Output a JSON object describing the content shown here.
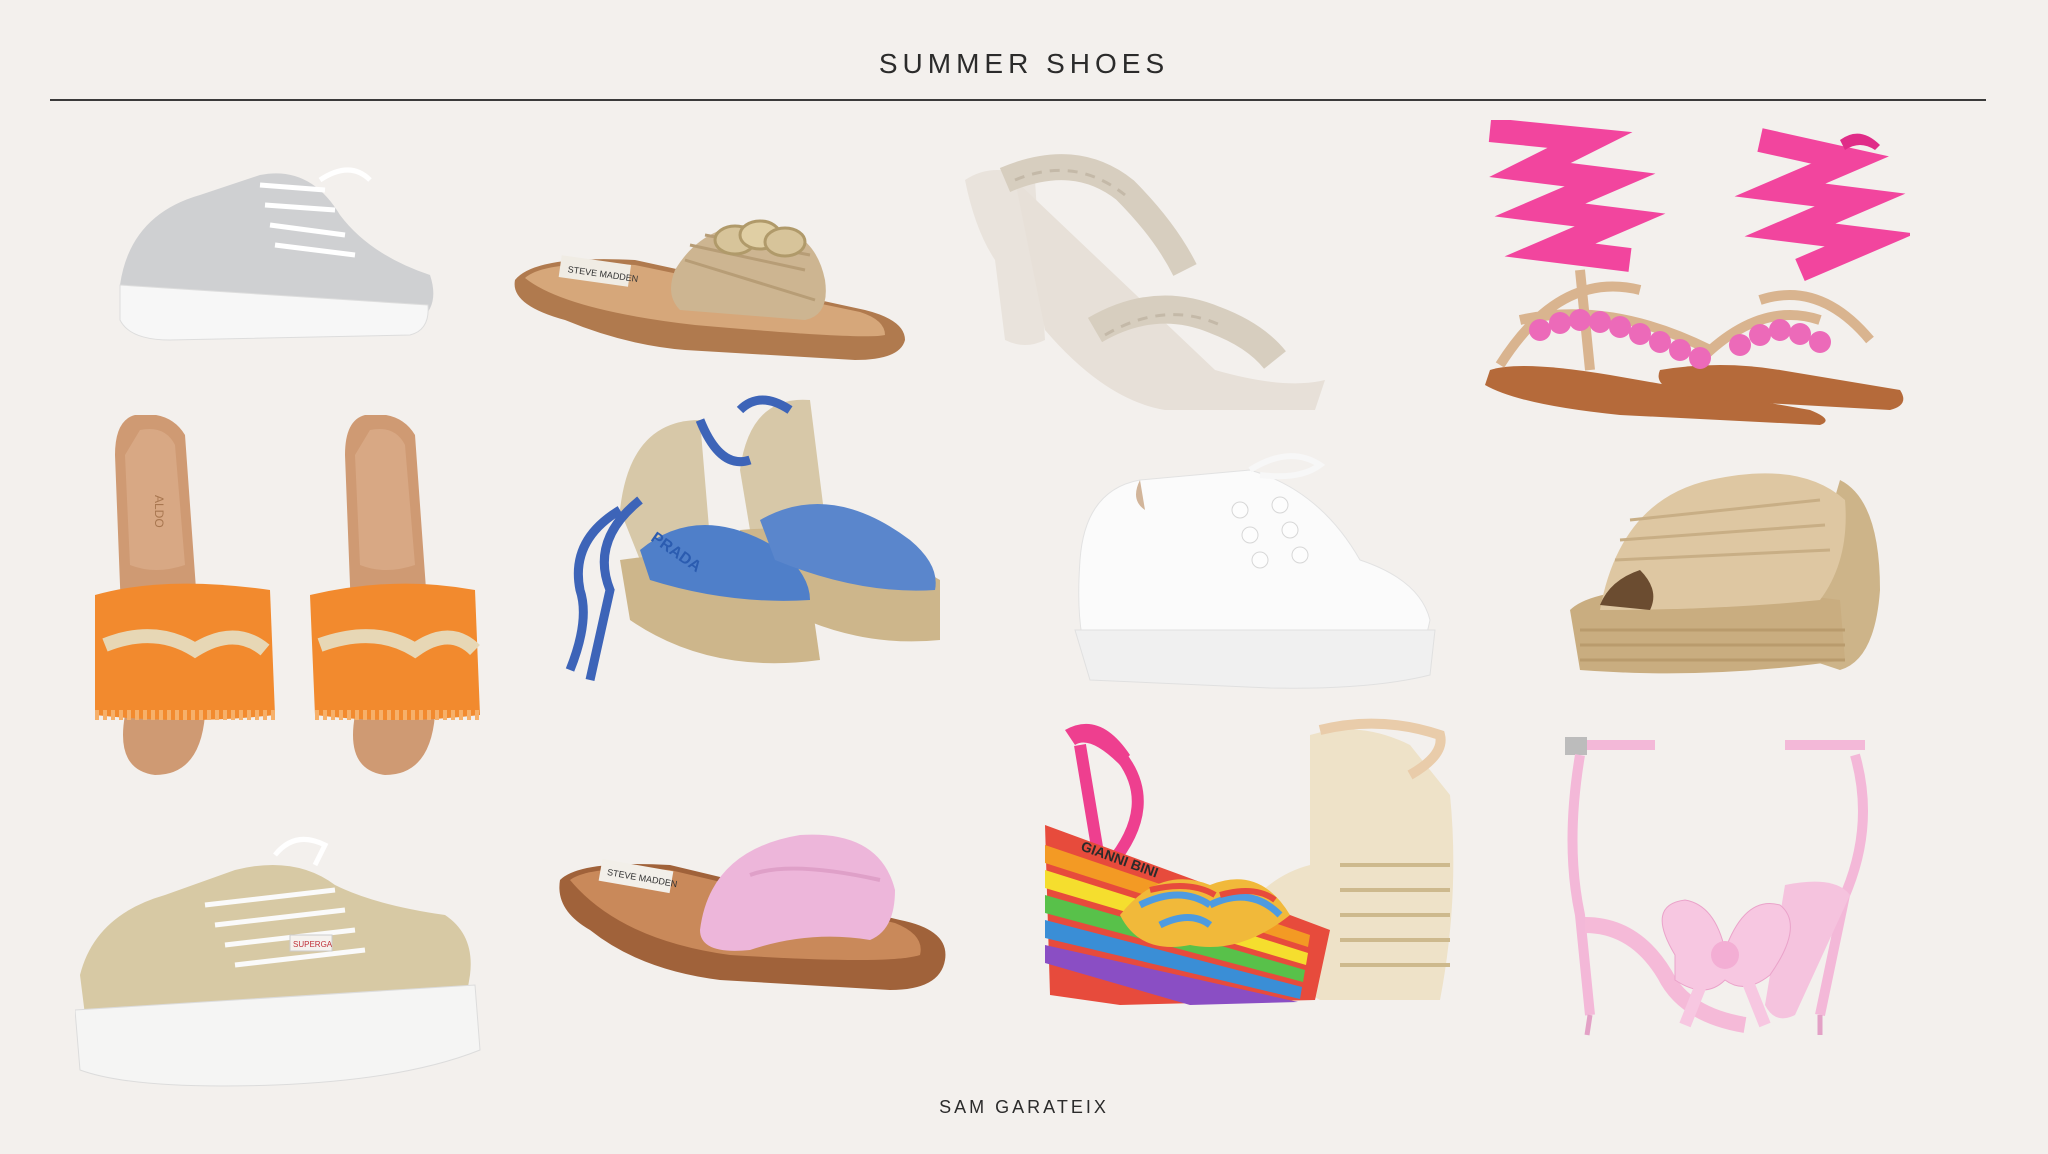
{
  "page": {
    "title": "SUMMER SHOES",
    "footer": "SAM GARATEIX"
  },
  "products": [
    {
      "id": "silver-sneaker",
      "label": ""
    },
    {
      "id": "woven-chain-slide",
      "brand": "STEVE MADDEN"
    },
    {
      "id": "braided-block-heel",
      "label": ""
    },
    {
      "id": "pink-ribbon-sandal",
      "label": ""
    },
    {
      "id": "orange-raffia-slide",
      "brand": "ALDO"
    },
    {
      "id": "blue-espadrille-wedge",
      "brand": "PRADA"
    },
    {
      "id": "white-pearl-sneaker",
      "label": ""
    },
    {
      "id": "raffia-platform-mule",
      "label": ""
    },
    {
      "id": "gold-platform-sneaker",
      "brand": "SUPERGA"
    },
    {
      "id": "pink-slide",
      "brand": "STEVE MADDEN"
    },
    {
      "id": "rainbow-wedge",
      "brand": "GIANNI BINI"
    },
    {
      "id": "pink-bow-heel",
      "label": ""
    }
  ],
  "colors": {
    "background": "#f3f0ed",
    "text": "#2b2b2b"
  }
}
